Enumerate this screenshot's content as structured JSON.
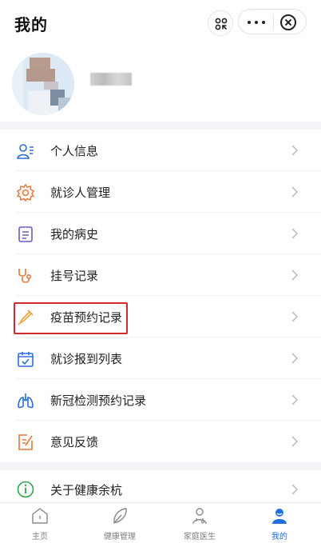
{
  "header": {
    "title": "我的"
  },
  "menu_primary": [
    {
      "label": "个人信息",
      "icon": "person-card-icon"
    },
    {
      "label": "就诊人管理",
      "icon": "gear-icon"
    },
    {
      "label": "我的病史",
      "icon": "document-icon"
    },
    {
      "label": "挂号记录",
      "icon": "stethoscope-icon"
    },
    {
      "label": "疫苗预约记录",
      "icon": "syringe-icon"
    },
    {
      "label": "就诊报到列表",
      "icon": "calendar-check-icon"
    },
    {
      "label": "新冠检测预约记录",
      "icon": "lungs-icon"
    },
    {
      "label": "意见反馈",
      "icon": "feedback-icon"
    }
  ],
  "menu_secondary": [
    {
      "label": "关于健康余杭",
      "icon": "info-icon"
    }
  ],
  "tabbar": [
    {
      "label": "主页",
      "icon": "home-icon",
      "active": false
    },
    {
      "label": "健康管理",
      "icon": "leaf-icon",
      "active": false
    },
    {
      "label": "家庭医生",
      "icon": "doctor-icon",
      "active": false
    },
    {
      "label": "我的",
      "icon": "user-icon",
      "active": true
    }
  ],
  "colors": {
    "accent": "#1f6fe0",
    "icon_orange": "#e8783a",
    "icon_blue": "#2a6fd6",
    "icon_green": "#2aa84a",
    "icon_purple": "#6a5ac8",
    "highlight_red": "#d12a2a",
    "section_band": "#f5f4f8"
  }
}
